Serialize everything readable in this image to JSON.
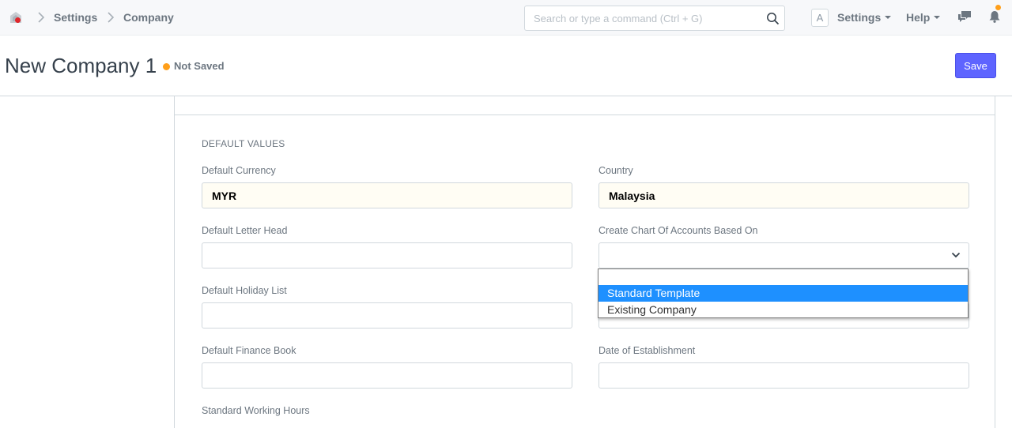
{
  "navbar": {
    "breadcrumbs": [
      "Settings",
      "Company"
    ],
    "search_placeholder": "Search or type a command (Ctrl + G)",
    "avatar_letter": "A",
    "settings_label": "Settings",
    "help_label": "Help"
  },
  "page": {
    "title": "New Company 1",
    "status": "Not Saved",
    "save_label": "Save"
  },
  "form": {
    "section_title": "DEFAULT VALUES",
    "default_currency": {
      "label": "Default Currency",
      "value": "MYR"
    },
    "country": {
      "label": "Country",
      "value": "Malaysia"
    },
    "default_letter_head": {
      "label": "Default Letter Head",
      "value": ""
    },
    "chart_of_accounts": {
      "label": "Create Chart Of Accounts Based On",
      "value": ""
    },
    "default_holiday_list": {
      "label": "Default Holiday List",
      "value": ""
    },
    "default_finance_book": {
      "label": "Default Finance Book",
      "value": ""
    },
    "date_of_establishment": {
      "label": "Date of Establishment",
      "value": ""
    },
    "standard_working_hours": {
      "label": "Standard Working Hours"
    }
  },
  "dropdown": {
    "options": [
      "",
      "Standard Template",
      "Existing Company"
    ],
    "highlighted": "Standard Template"
  },
  "colors": {
    "primary": "#5e64ff",
    "indicator_orange": "#ff9f1a",
    "highlight_blue": "#1e90ff"
  }
}
